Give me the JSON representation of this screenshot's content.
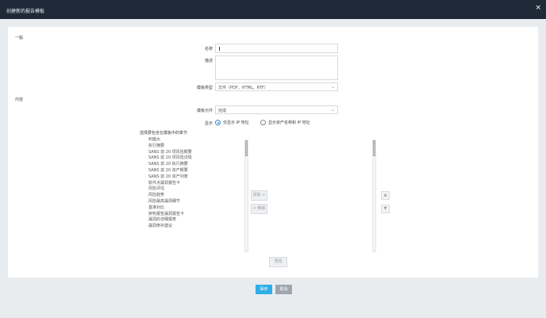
{
  "dialog": {
    "title": "创建新的报告模板",
    "close_icon": "×"
  },
  "sections": {
    "general": "一般",
    "content": "内容"
  },
  "form": {
    "name_label": "名称",
    "name_value": "",
    "description_label": "描述",
    "description_value": "",
    "template_type_label": "模板类型",
    "template_type_value": "文件（PDF，HTML，RTF）",
    "template_label": "模板元件",
    "template_value": "完成",
    "display_label": "显示",
    "radio_ip_only": "仅显示 IP 地址",
    "radio_ip_and_host": "显示资产名称和 IP 地址"
  },
  "chapters": {
    "title": "选择要包含在模板中的章节",
    "items": [
      "封面页",
      "执行摘要",
      "SANS 前 20 项风险概要",
      "SANS 前 20 项风险详情",
      "SANS 前 20 执行摘要",
      "SANS 前 20 资产概要",
      "SANS 前 20 资产列表",
      "软件点漏洞报告卡",
      "风险评估",
      "风险趋势",
      "风险最高漏洞细节",
      "基准对比",
      "架构报告漏洞报告卡",
      "漏洞的详细报表",
      "漏洞修补建议"
    ]
  },
  "transfer": {
    "add_label": "添加 >",
    "remove_label": "< 移除",
    "up_label": "▲",
    "down_label": "▼"
  },
  "preview_label": "预览",
  "footer": {
    "save_label": "保存",
    "cancel_label": "取消"
  },
  "colors": {
    "titlebar": "#1f2a38",
    "primary": "#2eaee6",
    "secondary": "#9fa6ad",
    "accent": "#2f86d6"
  }
}
